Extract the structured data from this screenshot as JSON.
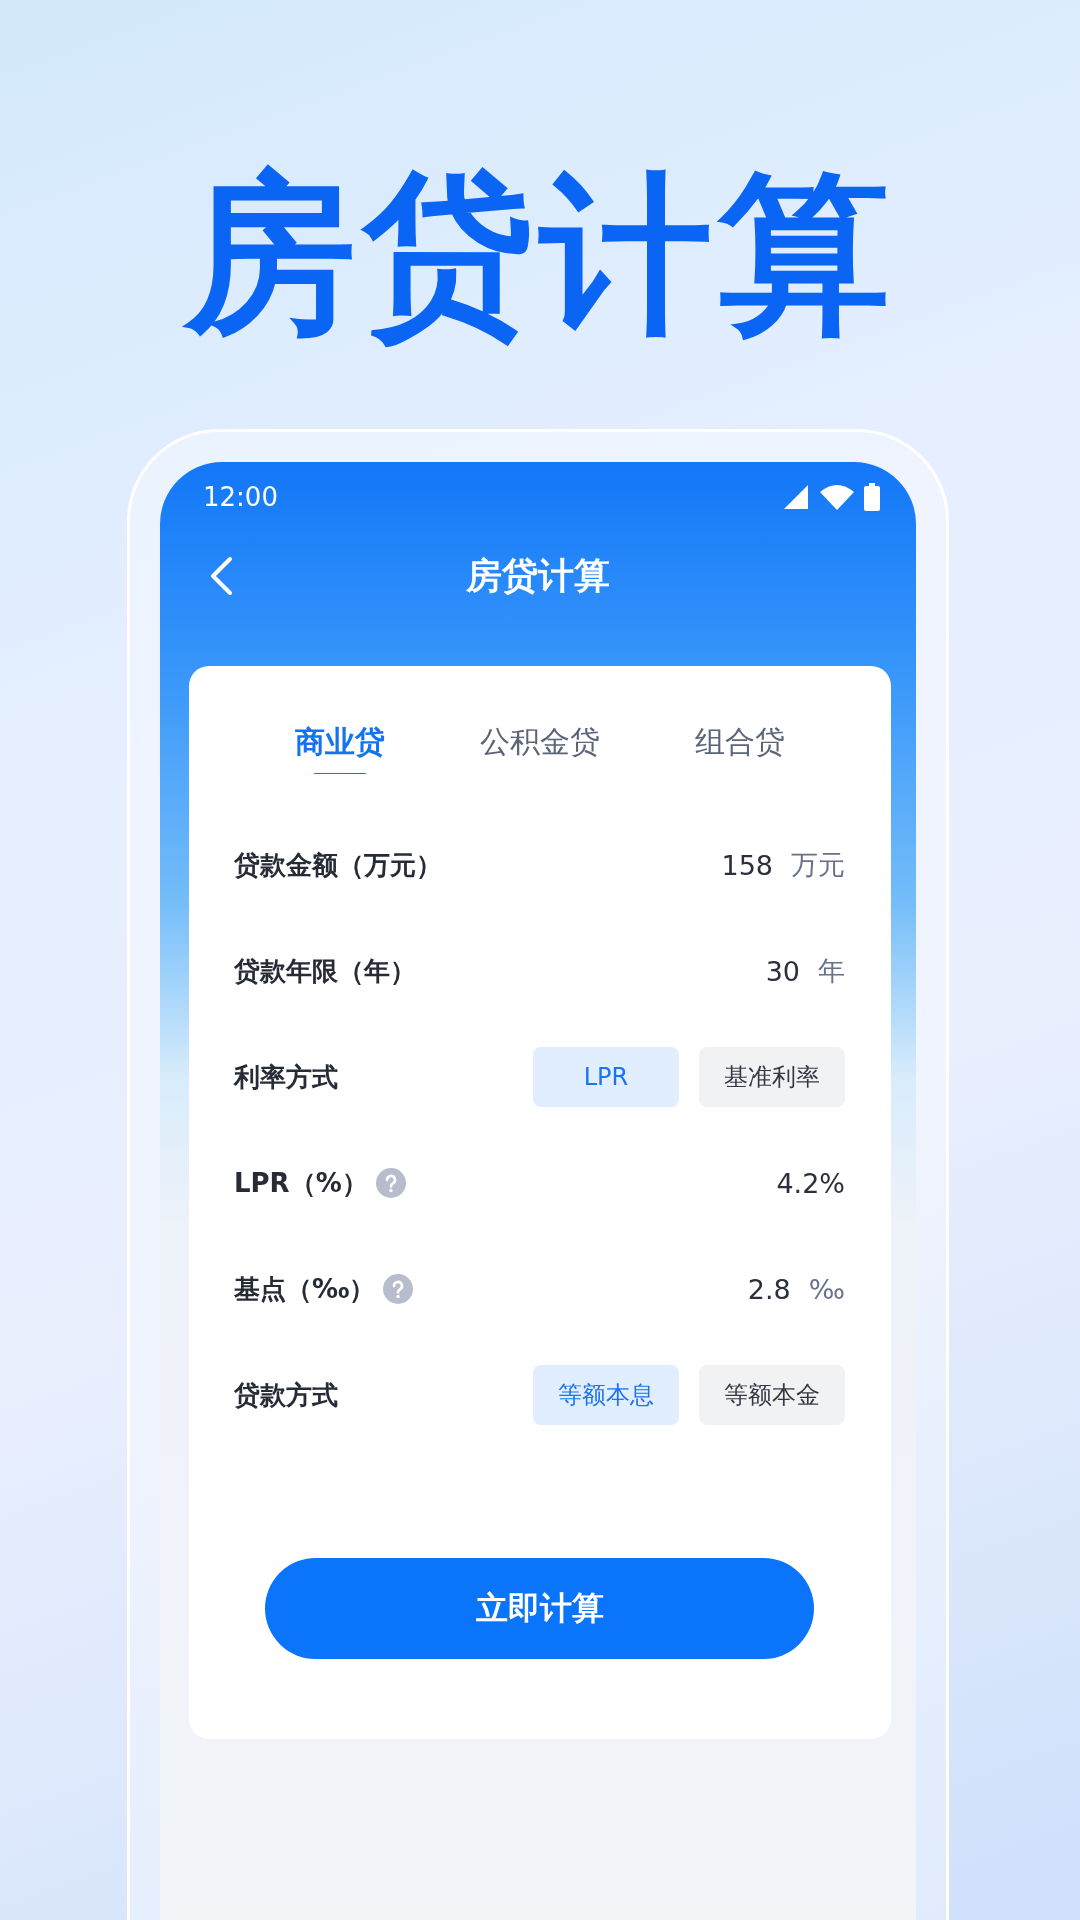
{
  "headline": "房贷计算",
  "status_bar": {
    "time": "12:00"
  },
  "nav": {
    "title": "房贷计算"
  },
  "tabs": [
    {
      "label": "商业贷",
      "selected": true
    },
    {
      "label": "公积金贷",
      "selected": false
    },
    {
      "label": "组合贷",
      "selected": false
    }
  ],
  "rows": [
    {
      "kind": "value",
      "label": "贷款金额（万元）",
      "value": "158",
      "unit": "万元"
    },
    {
      "kind": "value",
      "label": "贷款年限（年）",
      "value": "30",
      "unit": "年"
    },
    {
      "kind": "options",
      "label": "利率方式",
      "options": [
        {
          "label": "LPR",
          "selected": true
        },
        {
          "label": "基准利率",
          "selected": false
        }
      ]
    },
    {
      "kind": "value",
      "label": "LPR（%）",
      "help": true,
      "value": "4.2%"
    },
    {
      "kind": "value",
      "label": "基点（‰）",
      "help": true,
      "value": "2.8",
      "unit": "‰"
    },
    {
      "kind": "options",
      "label": "贷款方式",
      "options": [
        {
          "label": "等额本息",
          "selected": true
        },
        {
          "label": "等额本金",
          "selected": false
        }
      ]
    }
  ],
  "button": "立即计算"
}
